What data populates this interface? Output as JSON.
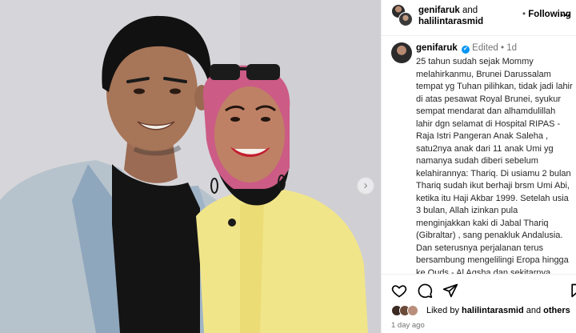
{
  "photo": {
    "alt_subject": "",
    "next_icon": "chevron-right-icon",
    "next_glyph": "›"
  },
  "header": {
    "user1": "genifaruk",
    "and": "and",
    "user2": "halilintarasmid",
    "dot": "•",
    "follow_label": "Following",
    "more_label": "..."
  },
  "post": {
    "username": "genifaruk",
    "verified_glyph": "✔",
    "edited_label": "Edited",
    "dot": "•",
    "age": "1d",
    "caption": "25 tahun sudah sejak Mommy melahirkanmu, Brunei Darussalam tempat yg Tuhan pilihkan, tidak jadi lahir di atas pesawat Royal Brunei, syukur sempat mendarat dan alhamdulillah lahir dgn selamat di Hospital RIPAS - Raja Istri Pangeran Anak Saleha , satu2nya anak dari 11 anak Umi yg namanya sudah diberi sebelum kelahirannya: Thariq. Di usiamu 2 bulan Thariq sudah ikut berhaji brsm Umi Abi, ketika itu Haji Akbar 1999. Setelah usia 3 bulan, Allah izinkan pula menginjakkan kaki di Jabal Thariq (Gibraltar) , sang penakluk Andalusia. Dan seterusnya perjalanan terus bersambung mengelilingi Eropa hingga ke Quds - Al Aqsha dan sekitarnya. Hinggalah Thor, Our Mighty"
  },
  "actions": {
    "icons": [
      "heart-icon",
      "comment-icon",
      "share-icon",
      "bookmark-icon"
    ],
    "liked_by_prefix": "Liked by",
    "liked_by_user": "halilintarasmid",
    "liked_by_and": "and",
    "liked_by_others": "others",
    "timestamp": "1 day ago"
  },
  "colors": {
    "verified": "#0095f6",
    "muted": "#737373",
    "border": "#efefef"
  }
}
